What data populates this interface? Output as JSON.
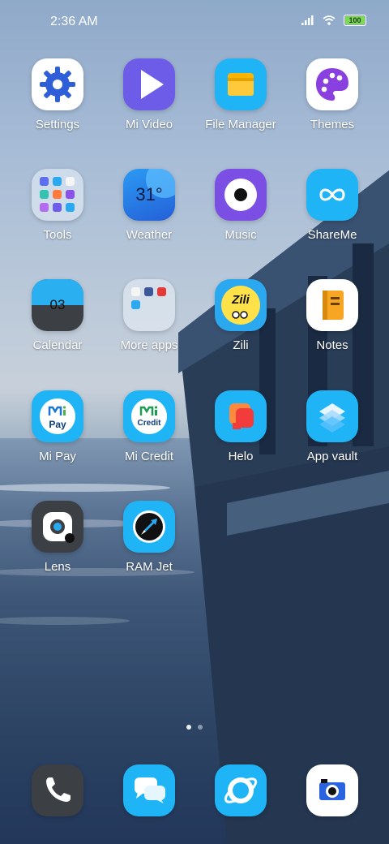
{
  "status_bar": {
    "time": "2:36 AM",
    "battery": "100",
    "icons": [
      "signal-icon",
      "wifi-icon",
      "battery-icon"
    ]
  },
  "apps": [
    {
      "label": "Settings"
    },
    {
      "label": "Mi Video"
    },
    {
      "label": "File Manager"
    },
    {
      "label": "Themes"
    },
    {
      "label": "Tools"
    },
    {
      "label": "Weather",
      "temperature": "31°"
    },
    {
      "label": "Music"
    },
    {
      "label": "ShareMe"
    },
    {
      "label": "Calendar",
      "date": "03"
    },
    {
      "label": "More apps"
    },
    {
      "label": "Zili",
      "badge": "Zili"
    },
    {
      "label": "Notes"
    },
    {
      "label": "Mi Pay",
      "logo_text": "Pay"
    },
    {
      "label": "Mi Credit",
      "logo_text": "Credit"
    },
    {
      "label": "Helo"
    },
    {
      "label": "App vault"
    },
    {
      "label": "Lens"
    },
    {
      "label": "RAM Jet"
    }
  ],
  "dock": [
    {
      "name": "phone-icon"
    },
    {
      "name": "messaging-icon"
    },
    {
      "name": "browser-icon"
    },
    {
      "name": "camera-icon"
    }
  ],
  "page_indicator": {
    "pages": 2,
    "active": 1
  },
  "colors": {
    "settings_bg": "#ffffff",
    "mivideo_bg": "#6c5ce7",
    "filemanager_bg": "#1fb4f5",
    "themes_bg": "#ffffff",
    "weather_bg": "#2f80ed",
    "music_bg": "#7b4fe3",
    "shareme_bg": "#1fb4f5",
    "calendar_top": "#2ab0f1",
    "zili_bg": "#2aa9f0",
    "notes_bg": "#ffffff",
    "mipay_bg": "#1fb4f5",
    "micredit_bg": "#1fb4f5",
    "helo_bg": "#1fb4f5",
    "appvault_bg": "#1fb4f5",
    "lens_bg": "#3c3f44",
    "ramjet_bg": "#1fb4f5",
    "phone_bg": "#3c3f44",
    "dock_blue": "#1fb4f5",
    "camera_bg": "#ffffff"
  }
}
